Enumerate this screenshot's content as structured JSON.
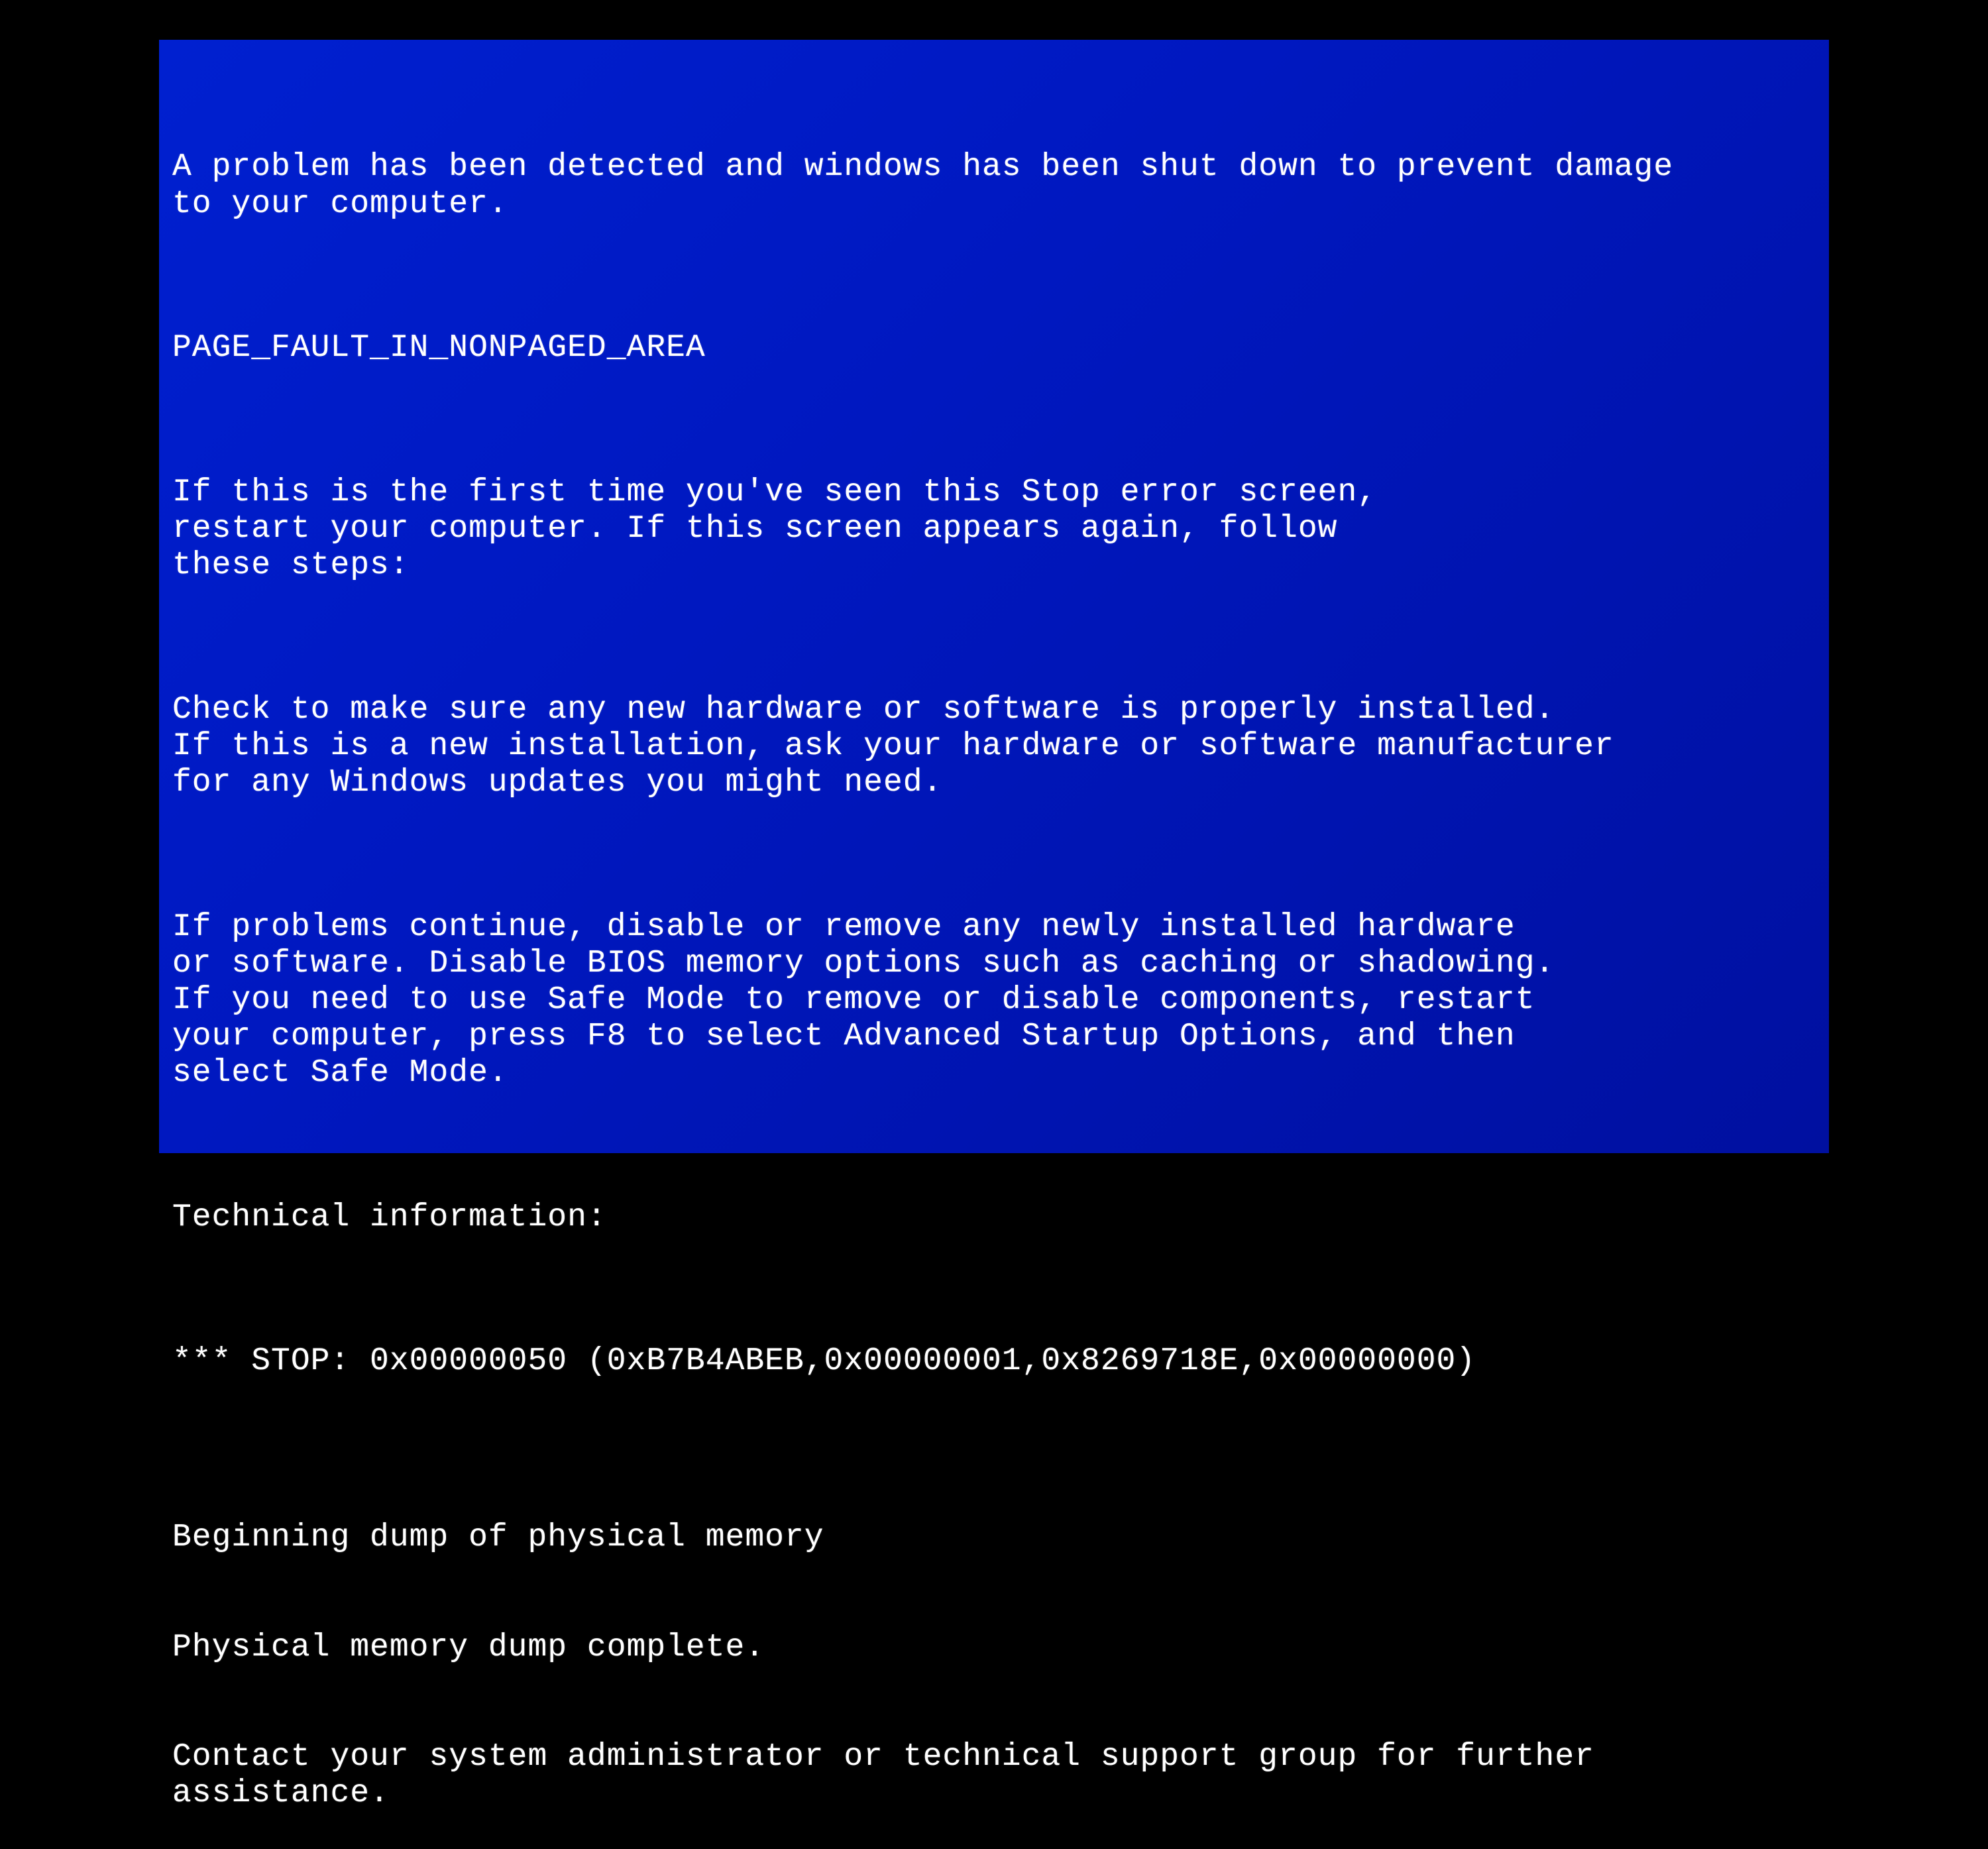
{
  "bsod": {
    "intro": "A problem has been detected and windows has been shut down to prevent damage\nto your computer.",
    "error_name": "PAGE_FAULT_IN_NONPAGED_AREA",
    "first_time": "If this is the first time you've seen this Stop error screen,\nrestart your computer. If this screen appears again, follow\nthese steps:",
    "check_hw": "Check to make sure any new hardware or software is properly installed.\nIf this is a new installation, ask your hardware or software manufacturer\nfor any Windows updates you might need.",
    "troubleshoot": "If problems continue, disable or remove any newly installed hardware\nor software. Disable BIOS memory options such as caching or shadowing.\nIf you need to use Safe Mode to remove or disable components, restart\nyour computer, press F8 to select Advanced Startup Options, and then\nselect Safe Mode.",
    "tech_header": "Technical information:",
    "stop_line": "*** STOP: 0x00000050 (0xB7B4ABEB,0x00000001,0x8269718E,0x00000000)",
    "dump_begin": "Beginning dump of physical memory",
    "dump_complete": "Physical memory dump complete.",
    "contact": "Contact your system administrator or technical support group for further\nassistance."
  }
}
